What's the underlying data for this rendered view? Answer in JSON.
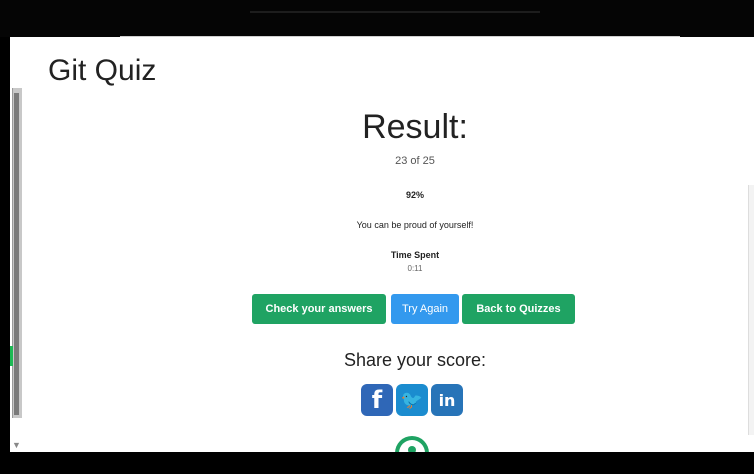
{
  "page": {
    "title": "Git Quiz",
    "result_heading": "Result:",
    "score": "23 of 25",
    "percent": "92%",
    "message": "You can be proud of yourself!",
    "time_label": "Time Spent",
    "time_value": "0:11"
  },
  "buttons": {
    "check": "Check your answers",
    "try_again": "Try Again",
    "back": "Back to Quizzes"
  },
  "share": {
    "label": "Share your score:",
    "facebook_icon": "f",
    "twitter_icon": "🐦",
    "linkedin_icon": "in"
  },
  "colors": {
    "primary_green": "#1fa363",
    "primary_blue": "#3399ee",
    "facebook": "#2f67b7",
    "twitter": "#1b8ccf",
    "linkedin": "#2774b8"
  }
}
